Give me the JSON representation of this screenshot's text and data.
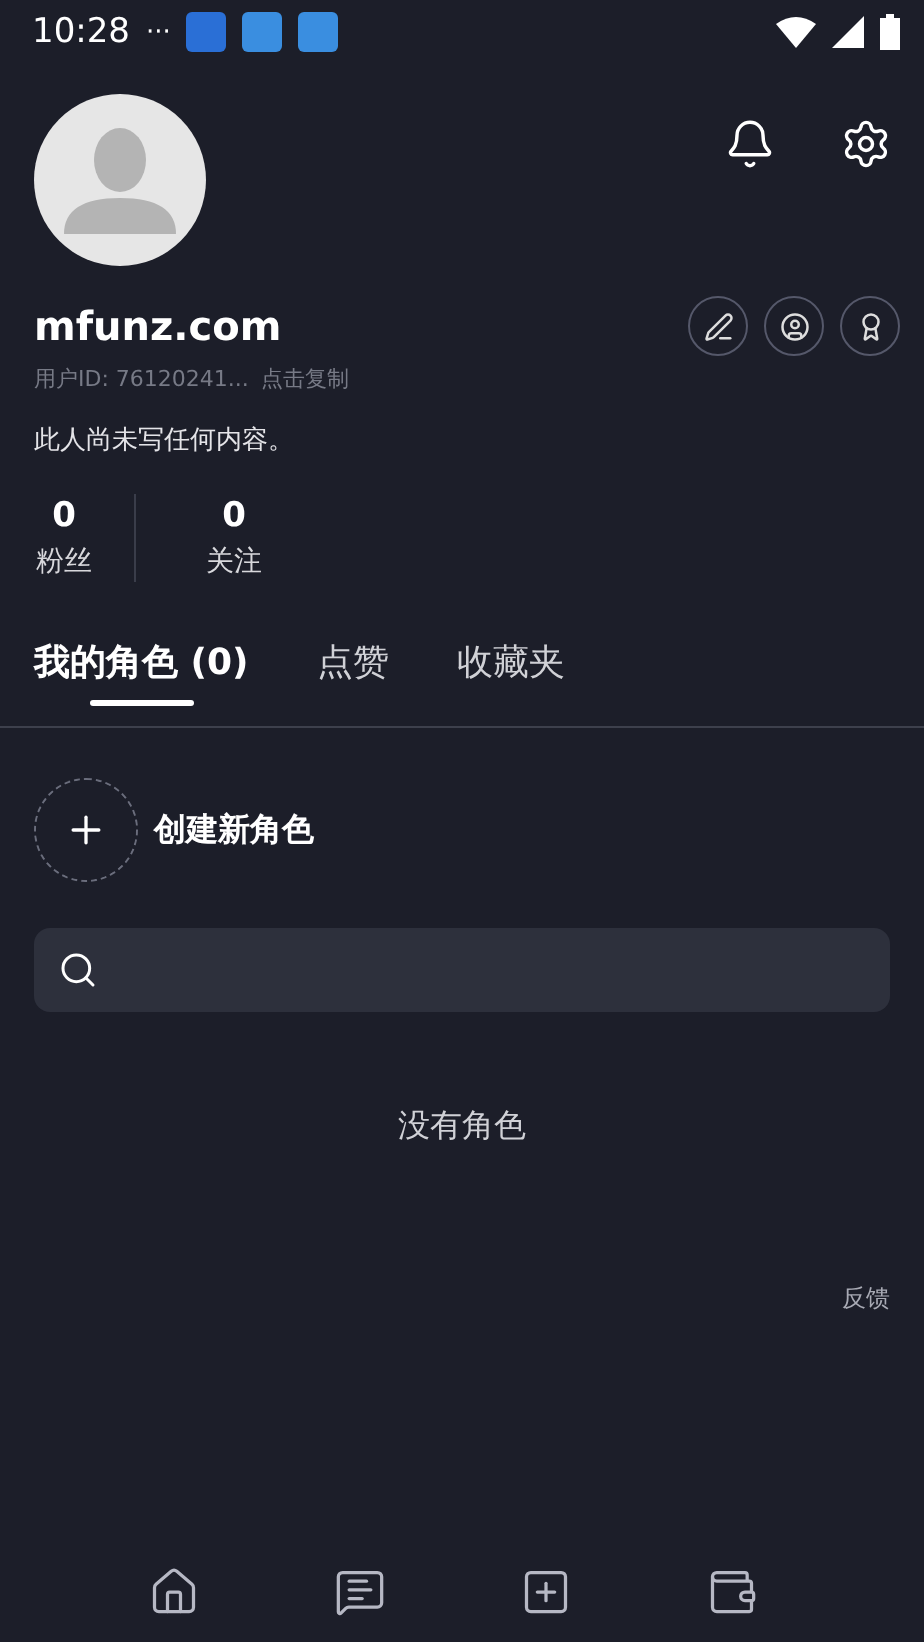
{
  "status_bar": {
    "time": "10:28",
    "more": "···"
  },
  "profile": {
    "name": "mfunz.com",
    "user_id": "用户ID: 76120241...",
    "copy": "点击复制",
    "bio": "此人尚未写任何内容。"
  },
  "stats": [
    {
      "value": "0",
      "label": "粉丝"
    },
    {
      "value": "0",
      "label": "关注"
    }
  ],
  "tabs": [
    {
      "label": "我的角色 (0)",
      "selected": true
    },
    {
      "label": "点赞",
      "selected": false
    },
    {
      "label": "收藏夹",
      "selected": false
    }
  ],
  "create": {
    "label": "创建新角色"
  },
  "empty_text": "没有角色",
  "feedback": "反馈",
  "nav": [
    {
      "kind": "home"
    },
    {
      "kind": "chat"
    },
    {
      "kind": "add"
    },
    {
      "kind": "wallet"
    }
  ]
}
